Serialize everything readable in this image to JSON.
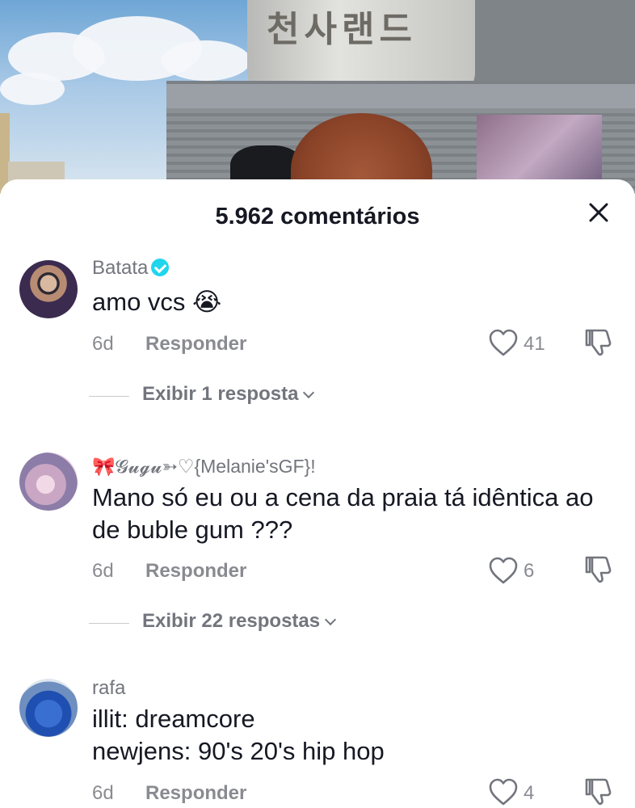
{
  "header": {
    "title": "5.962 comentários"
  },
  "comments": [
    {
      "username": "Batata",
      "verified": true,
      "text": "amo vcs 😭",
      "time": "6d",
      "reply_label": "Responder",
      "likes": "41",
      "view_replies": "Exibir 1 resposta"
    },
    {
      "username": "🎀𝓖𝓾𝓰𝓾➳♡{Melanie'sGF}!",
      "verified": false,
      "text": "Mano só eu ou a cena da praia tá idêntica ao de buble gum ???",
      "time": "6d",
      "reply_label": "Responder",
      "likes": "6",
      "view_replies": "Exibir 22 respostas"
    },
    {
      "username": "rafa",
      "verified": false,
      "text_line1": "illit: dreamcore",
      "text_line2": "newjens: 90's 20's hip hop",
      "time": "6d",
      "reply_label": "Responder",
      "likes": "4"
    }
  ],
  "icons": {
    "close": "close-icon",
    "like": "heart-icon",
    "dislike": "thumbs-down-icon",
    "verified": "verified-badge-icon"
  }
}
